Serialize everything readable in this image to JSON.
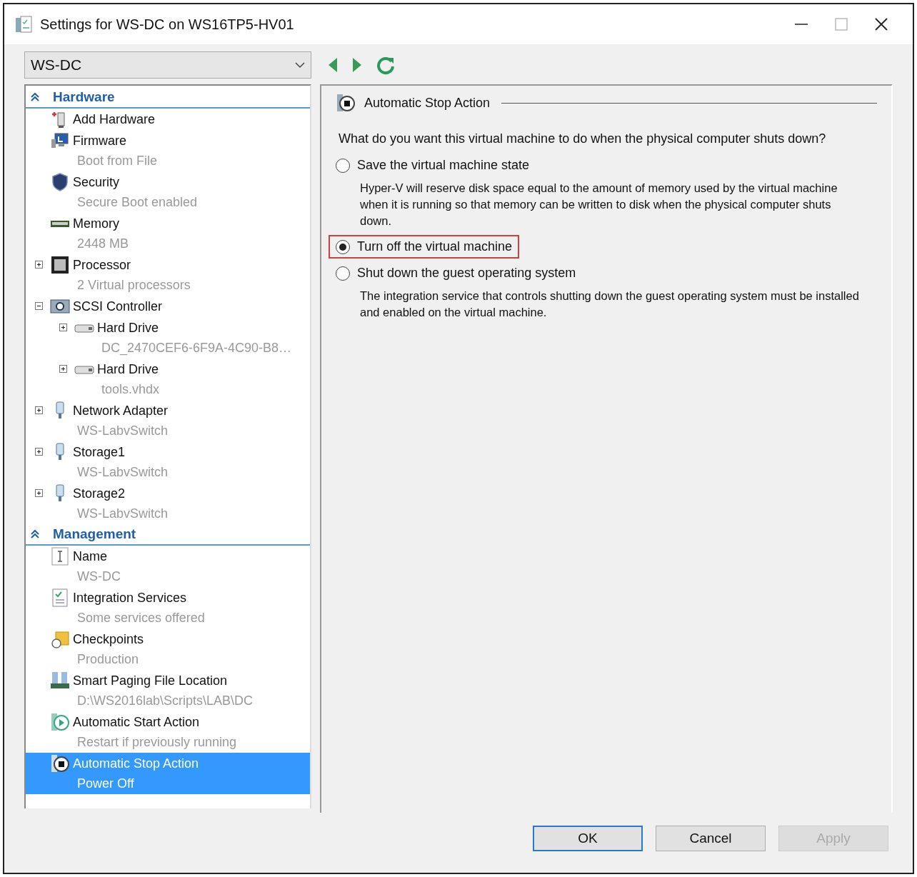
{
  "window": {
    "title": "Settings for WS-DC on WS16TP5-HV01"
  },
  "vm_selector": {
    "value": "WS-DC"
  },
  "sections": [
    {
      "title": "Hardware",
      "items": [
        {
          "kind": "addhardware",
          "label": "Add Hardware",
          "selected": false
        },
        {
          "kind": "firmware",
          "label": "Firmware",
          "detail": "Boot from File",
          "selected": false
        },
        {
          "kind": "security",
          "label": "Security",
          "detail": "Secure Boot enabled",
          "selected": false
        },
        {
          "kind": "memory",
          "label": "Memory",
          "detail": "2448 MB",
          "selected": false
        },
        {
          "kind": "processor",
          "label": "Processor",
          "detail": "2 Virtual processors",
          "expanded": false,
          "selected": false
        },
        {
          "kind": "controller",
          "label": "SCSI Controller",
          "expanded": true,
          "selected": false,
          "children": [
            {
              "kind": "disk",
              "label": "Hard Drive",
              "detail": "DC_2470CEF6-6F9A-4C90-B8…",
              "expanded": false,
              "selected": false
            },
            {
              "kind": "disk",
              "label": "Hard Drive",
              "detail": "tools.vhdx",
              "expanded": false,
              "selected": false
            }
          ]
        },
        {
          "kind": "adapter",
          "label": "Network Adapter",
          "detail": "WS-LabvSwitch",
          "expanded": false,
          "selected": false
        },
        {
          "kind": "adapter",
          "label": "Storage1",
          "detail": "WS-LabvSwitch",
          "expanded": false,
          "selected": false
        },
        {
          "kind": "adapter",
          "label": "Storage2",
          "detail": "WS-LabvSwitch",
          "expanded": false,
          "selected": false
        }
      ]
    },
    {
      "title": "Management",
      "items": [
        {
          "kind": "name",
          "label": "Name",
          "detail": "WS-DC",
          "selected": false
        },
        {
          "kind": "integration",
          "label": "Integration Services",
          "detail": "Some services offered",
          "selected": false
        },
        {
          "kind": "checkpoints",
          "label": "Checkpoints",
          "detail": "Production",
          "selected": false
        },
        {
          "kind": "paging",
          "label": "Smart Paging File Location",
          "detail": "D:\\WS2016lab\\Scripts\\LAB\\DC",
          "selected": false
        },
        {
          "kind": "autostart",
          "label": "Automatic Start Action",
          "detail": "Restart if previously running",
          "selected": false
        },
        {
          "kind": "autostop",
          "label": "Automatic Stop Action",
          "detail": "Power Off",
          "selected": true
        }
      ]
    }
  ],
  "panel": {
    "title": "Automatic Stop Action",
    "question": "What do you want this virtual machine to do when the physical computer shuts down?",
    "options": [
      {
        "label": "Save the virtual machine state",
        "description": "Hyper-V will reserve disk space equal to the amount of memory used by the virtual machine when it is running so that memory can be written to disk when the physical computer shuts down.",
        "selected": false,
        "highlighted": false
      },
      {
        "label": "Turn off the virtual machine",
        "selected": true,
        "highlighted": true
      },
      {
        "label": "Shut down the guest operating system",
        "description": "The integration service that controls shutting down the guest operating system must be installed and enabled on the virtual machine.",
        "selected": false,
        "highlighted": false
      }
    ]
  },
  "buttons": [
    {
      "label": "OK",
      "default": true,
      "disabled": false
    },
    {
      "label": "Cancel",
      "default": false,
      "disabled": false
    },
    {
      "label": "Apply",
      "default": false,
      "disabled": true
    }
  ]
}
